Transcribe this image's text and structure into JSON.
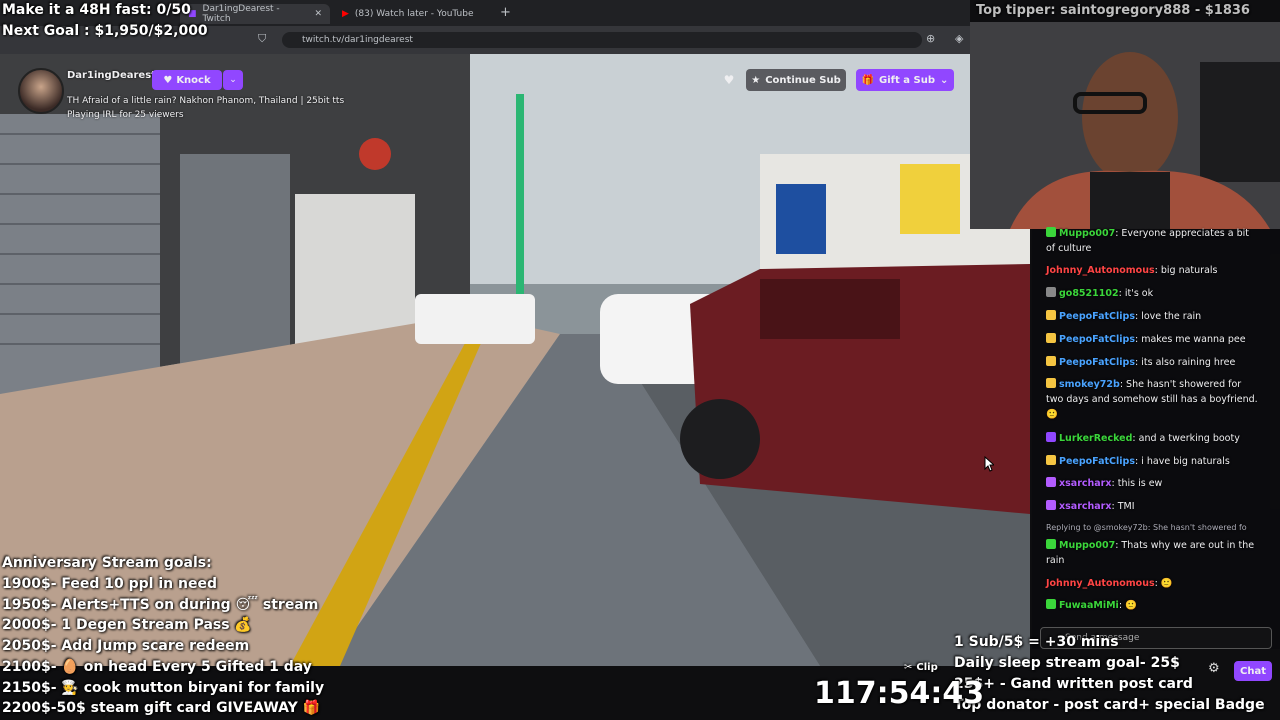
{
  "browser": {
    "tabs": [
      {
        "label": "Dar1ingDearest - Twitch",
        "active": true
      },
      {
        "label": "(83) Watch later - YouTube",
        "active": false
      }
    ],
    "url": "twitch.tv/dar1ingdearest"
  },
  "channel": {
    "name": "Dar1ingDearest",
    "knock_label": "Knock",
    "title": "TH Afraid of a little rain? Nakhon Phanom, Thailand | 25bit tts",
    "playing": "Playing IRL for 25 viewers",
    "continue_sub": "Continue Sub",
    "gift_sub": "Gift a Sub"
  },
  "overlay": {
    "goal_fast": "Make it a 48H fast: 0/50",
    "next_goal": "Next Goal : $1,950/$2,000",
    "top_tipper": "Top tipper: saintogregory888 - $1836",
    "anniversary_title": "Anniversary Stream goals:",
    "goals": [
      "1900$- Feed 10 ppl in need",
      "1950$- Alerts+TTS on during 😴 stream",
      "2000$- 1 Degen Stream Pass 💰",
      "2050$- Add Jump scare redeem",
      "2100$- 🥚 on head Every 5 Gifted 1 day",
      "2150$- 🧑‍🍳 cook mutton biryani for family",
      "2200$-50$ steam gift card GIVEAWAY 🎁"
    ],
    "right_lines": [
      "1 Sub/5$ = +30 mins",
      "Daily sleep stream goal- 25$",
      "25$+ - Gand written post card",
      "Top donator - post card+ special Badge"
    ],
    "timer": "117:54:43",
    "clip_label": "Clip"
  },
  "chat": {
    "messages": [
      {
        "user": "Muppo007",
        "color": "#3bd63b",
        "text": "Everyone appreciates a bit of culture"
      },
      {
        "user": "Johnny_Autonomous",
        "color": "#ff4545",
        "text": "big naturals"
      },
      {
        "user": "go8521102",
        "color": "#3bd63b",
        "text": "it's ok"
      },
      {
        "user": "PeepoFatClips",
        "color": "#4aa3ff",
        "text": "love the rain"
      },
      {
        "user": "PeepoFatClips",
        "color": "#4aa3ff",
        "text": "makes me wanna pee"
      },
      {
        "user": "PeepoFatClips",
        "color": "#4aa3ff",
        "text": "its also raining hree"
      },
      {
        "user": "smokey72b",
        "color": "#4aa3ff",
        "text": "She hasn't showered for two days and somehow still has a boyfriend. 🙂"
      },
      {
        "user": "LurkerRecked",
        "color": "#3bd63b",
        "text": "and a twerking booty"
      },
      {
        "user": "PeepoFatClips",
        "color": "#4aa3ff",
        "text": "i have big naturals"
      },
      {
        "user": "xsarcharx",
        "color": "#b35cff",
        "text": "this is ew"
      },
      {
        "user": "xsarcharx",
        "color": "#b35cff",
        "text": "TMI"
      },
      {
        "user": "Muppo007",
        "color": "#3bd63b",
        "text": "Thats why we are out in the rain",
        "reply": "Replying to @smokey72b: She hasn't showered fo"
      },
      {
        "user": "Johnny_Autonomous",
        "color": "#ff4545",
        "text": ""
      },
      {
        "user": "FuwaaMiMi",
        "color": "#3bd63b",
        "text": ""
      }
    ],
    "input_placeholder": "Send a message",
    "chat_button": "Chat"
  },
  "colors": {
    "twitch_purple": "#9147ff",
    "chat_bg": "#0e0e10"
  }
}
